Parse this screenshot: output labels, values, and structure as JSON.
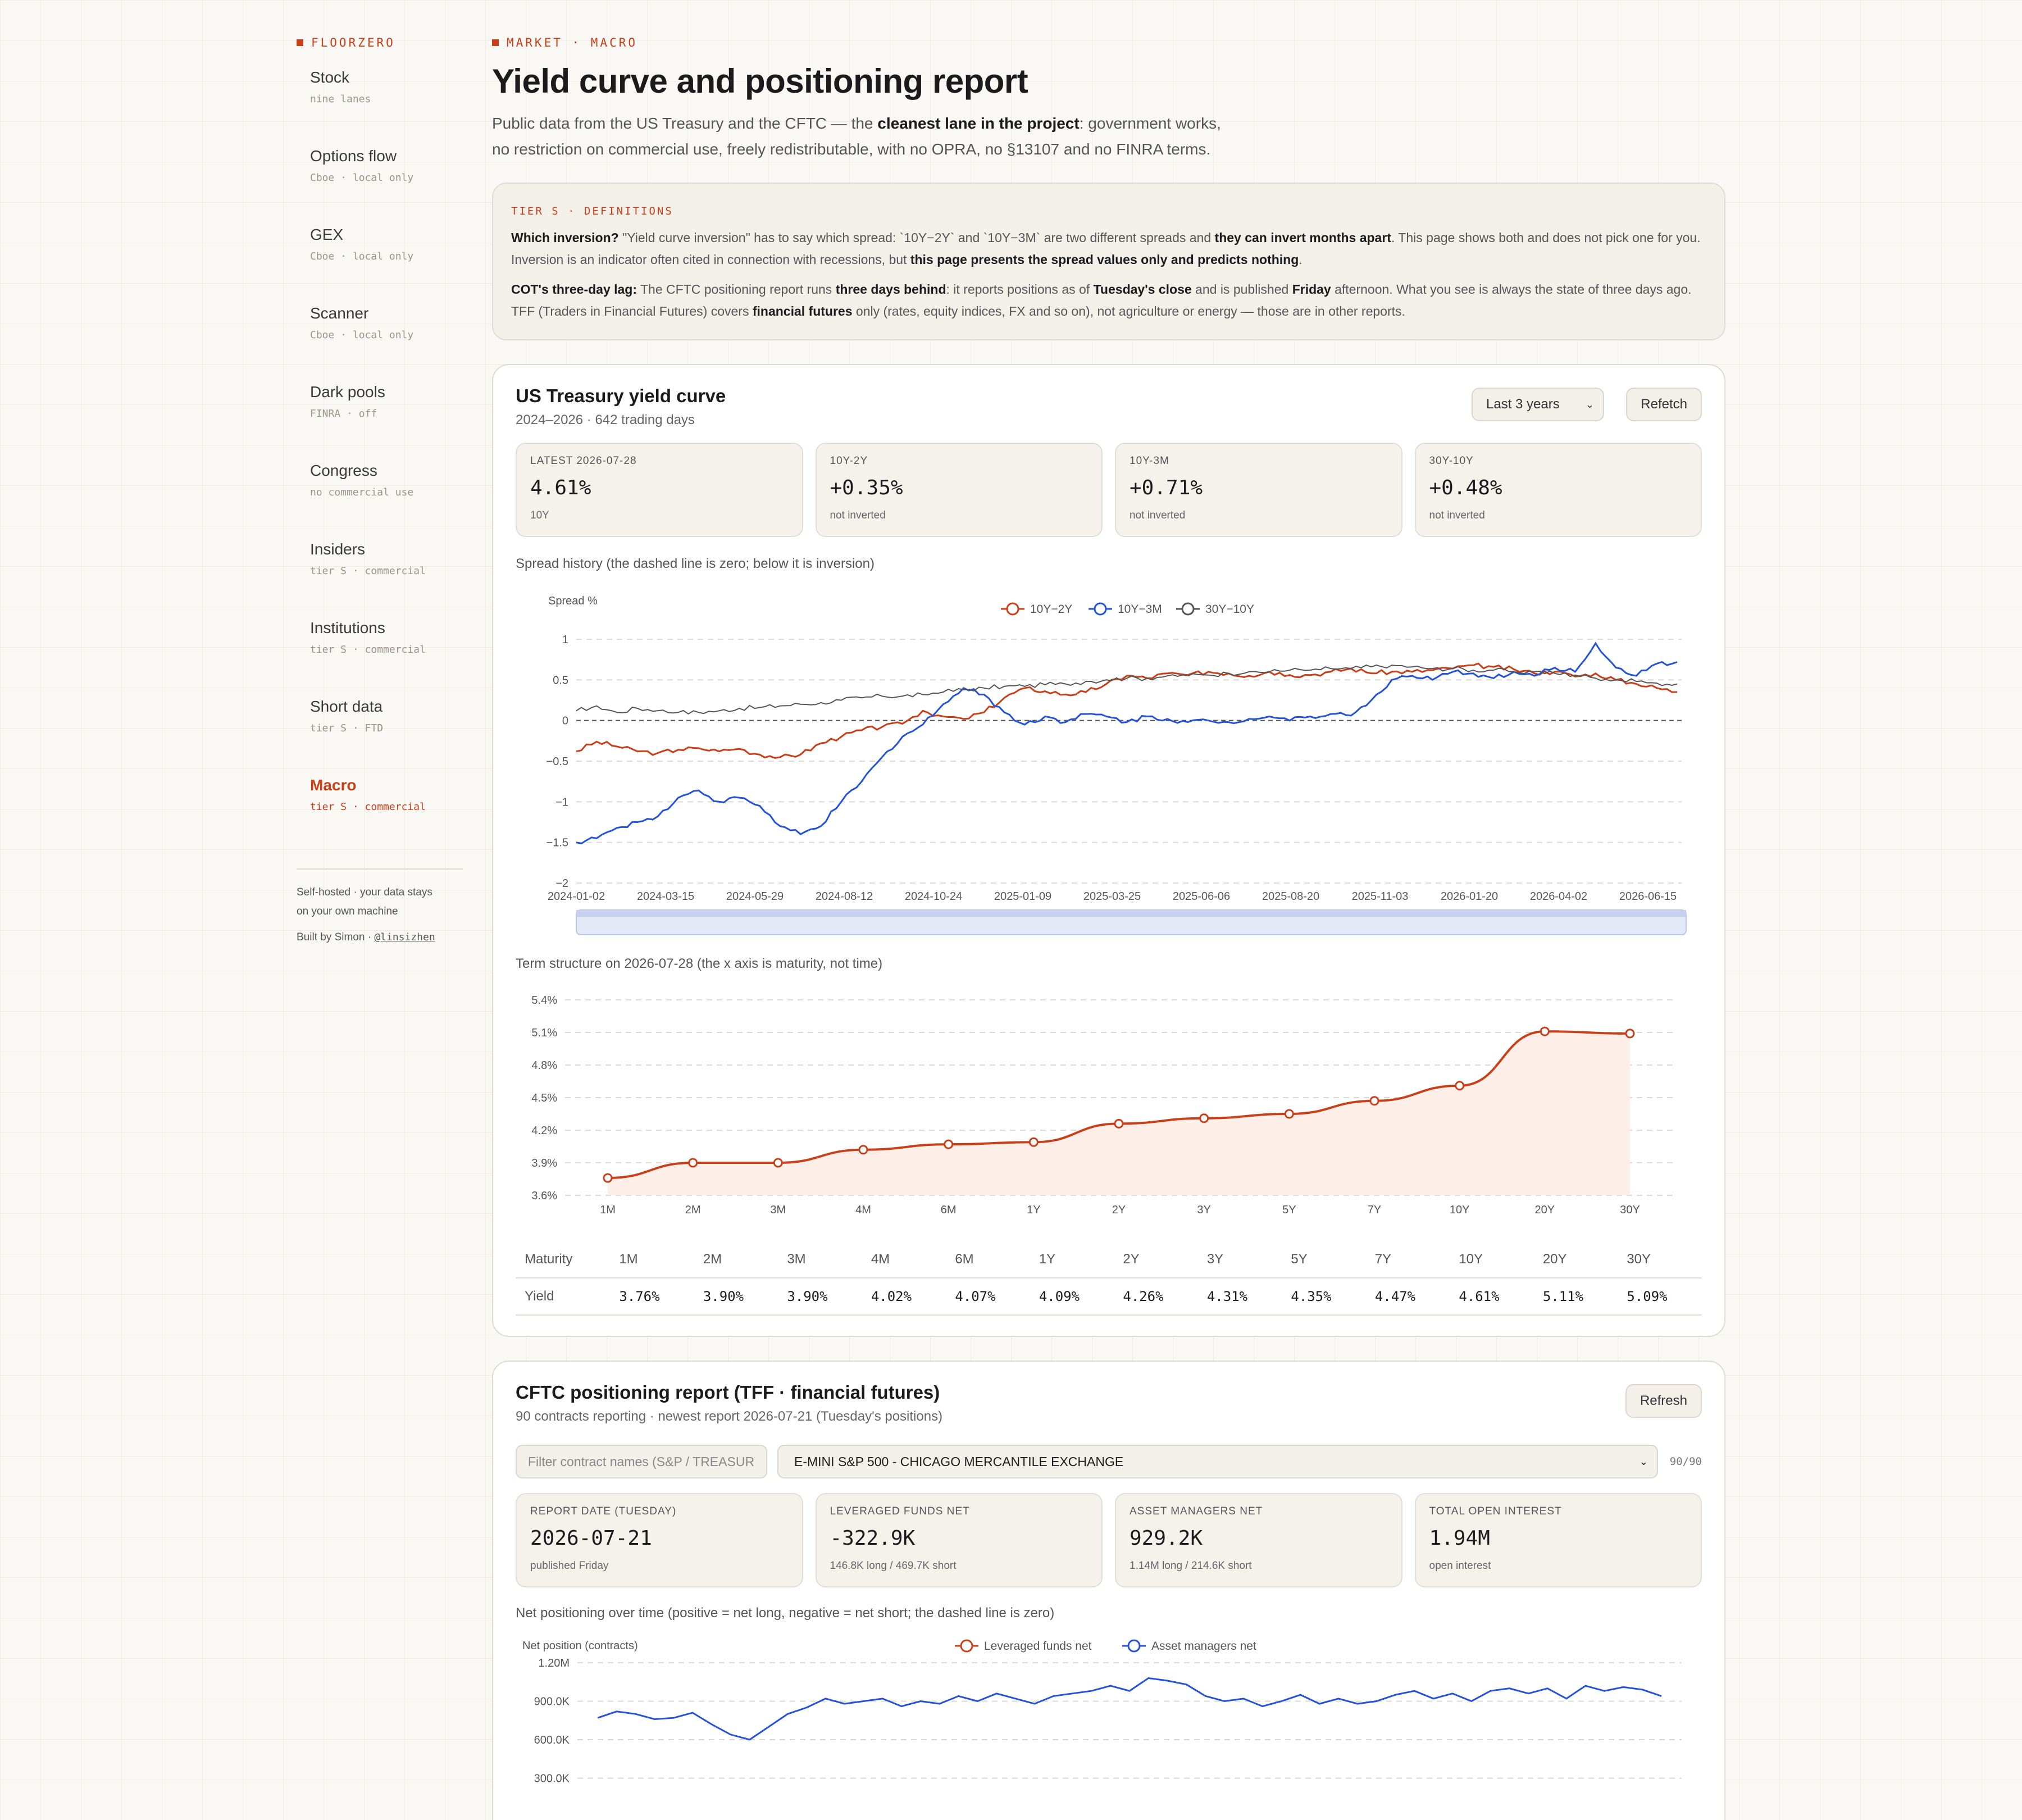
{
  "sidebar": {
    "brand": "FLOORZERO",
    "items": [
      {
        "title": "Stock",
        "sub": "nine lanes"
      },
      {
        "title": "Options flow",
        "sub": "Cboe · local only"
      },
      {
        "title": "GEX",
        "sub": "Cboe · local only"
      },
      {
        "title": "Scanner",
        "sub": "Cboe · local only"
      },
      {
        "title": "Dark pools",
        "sub": "FINRA · off"
      },
      {
        "title": "Congress",
        "sub": "no commercial use"
      },
      {
        "title": "Insiders",
        "sub": "tier S · commercial"
      },
      {
        "title": "Institutions",
        "sub": "tier S · commercial"
      },
      {
        "title": "Short data",
        "sub": "tier S · FTD"
      },
      {
        "title": "Macro",
        "sub": "tier S · commercial"
      }
    ],
    "footer_line1": "Self-hosted · your data stays",
    "footer_line2": "on your own machine",
    "built_by": "Built by Simon · ",
    "handle": "@linsizhen"
  },
  "header": {
    "crumb": "MARKET · MACRO",
    "title": "Yield curve and positioning report",
    "intro_a": "Public data from the US Treasury and the CFTC — the ",
    "intro_b": "cleanest lane in the project",
    "intro_c": ": government works, no restriction on commercial use, freely redistributable, with no OPRA, no §13107 and no FINRA terms."
  },
  "definitions": {
    "tag": "TIER S · DEFINITIONS",
    "p1_q": "Which inversion?",
    "p1_a": " \"Yield curve inversion\" has to say which spread: `10Y−2Y` and `10Y−3M` are two different spreads and ",
    "p1_b": "they can invert months apart",
    "p1_c": ". This page shows both and does not pick one for you. Inversion is an indicator often cited in connection with recessions, but ",
    "p1_d": "this page presents the spread values only and predicts nothing",
    "p1_e": ".",
    "p2_q": "COT's three-day lag:",
    "p2_a": " The CFTC positioning report runs ",
    "p2_b": "three days behind",
    "p2_c": ": it reports positions as of ",
    "p2_d": "Tuesday's close",
    "p2_e": " and is published ",
    "p2_f": "Friday",
    "p2_g": " afternoon. What you see is always the state of three days ago. TFF (Traders in Financial Futures) covers ",
    "p2_h": "financial futures",
    "p2_i": " only (rates, equity indices, FX and so on), not agriculture or energy — those are in other reports."
  },
  "yield_card": {
    "title": "US Treasury yield curve",
    "subtitle": "2024–2026 · 642 trading days",
    "range": "Last 3 years",
    "refetch": "Refetch",
    "stats": [
      {
        "label": "LATEST 2026-07-28",
        "value": "4.61%",
        "note": "10Y"
      },
      {
        "label": "10Y-2Y",
        "value": "+0.35%",
        "note": "not inverted"
      },
      {
        "label": "10Y-3M",
        "value": "+0.71%",
        "note": "not inverted"
      },
      {
        "label": "30Y-10Y",
        "value": "+0.48%",
        "note": "not inverted"
      }
    ],
    "spread_label": "Spread history (the dashed line is zero; below it is inversion)",
    "term_label": "Term structure on 2026-07-28 (the x axis is maturity, not time)",
    "table_head": "Maturity",
    "table_row": "Yield"
  },
  "cot_card": {
    "title": "CFTC positioning report (TFF · financial futures)",
    "subtitle": "90 contracts reporting · newest report 2026-07-21 (Tuesday's positions)",
    "refresh": "Refresh",
    "filter_placeholder": "Filter contract names (S&P / TREASURY …)",
    "contract": "E-MINI S&P 500 - CHICAGO MERCANTILE EXCHANGE",
    "count": "90/90",
    "stats": [
      {
        "label": "REPORT DATE (TUESDAY)",
        "value": "2026-07-21",
        "note": "published Friday"
      },
      {
        "label": "LEVERAGED FUNDS NET",
        "value": "-322.9K",
        "note": "146.8K long / 469.7K short"
      },
      {
        "label": "ASSET MANAGERS NET",
        "value": "929.2K",
        "note": "1.14M long / 214.6K short"
      },
      {
        "label": "TOTAL OPEN INTEREST",
        "value": "1.94M",
        "note": "open interest"
      }
    ],
    "net_label": "Net positioning over time (positive = net long, negative = net short; the dashed line is zero)"
  },
  "colors": {
    "accent": "#c8401a",
    "blue": "#2553d6",
    "grey": "#555555"
  },
  "chart_data": [
    {
      "type": "line",
      "ylabel": "Spread %",
      "ylim": [
        -2,
        1
      ],
      "yticks": [
        1,
        0.5,
        0,
        -0.5,
        -1,
        -1.5,
        -2
      ],
      "xticks": [
        "2024-01-02",
        "2024-03-15",
        "2024-05-29",
        "2024-08-12",
        "2024-10-24",
        "2025-01-09",
        "2025-03-25",
        "2025-06-06",
        "2025-08-20",
        "2025-11-03",
        "2026-01-20",
        "2026-04-02",
        "2026-06-15"
      ],
      "legend_position": "top-center",
      "series": [
        {
          "name": "10Y−2Y",
          "color": "#c8401a",
          "values": [
            -0.38,
            -0.26,
            -0.32,
            -0.38,
            -0.4,
            -0.36,
            -0.34,
            -0.38,
            -0.35,
            -0.42,
            -0.45,
            -0.42,
            -0.28,
            -0.2,
            -0.12,
            -0.08,
            -0.04,
            0.12,
            0.05,
            0.02,
            0.1,
            0.28,
            0.4,
            0.36,
            0.32,
            0.35,
            0.45,
            0.55,
            0.52,
            0.58,
            0.56,
            0.6,
            0.58,
            0.55,
            0.6,
            0.56,
            0.56,
            0.6,
            0.64,
            0.58,
            0.6,
            0.6,
            0.62,
            0.64,
            0.68,
            0.66,
            0.63,
            0.58,
            0.6,
            0.54,
            0.58,
            0.5,
            0.45,
            0.4,
            0.35
          ]
        },
        {
          "name": "10Y−3M",
          "color": "#2553d6",
          "values": [
            -1.5,
            -1.45,
            -1.32,
            -1.25,
            -1.18,
            -0.95,
            -0.86,
            -1.0,
            -0.95,
            -1.05,
            -1.3,
            -1.4,
            -1.3,
            -1.0,
            -0.75,
            -0.45,
            -0.2,
            -0.05,
            0.2,
            0.4,
            0.32,
            0.1,
            -0.05,
            0.05,
            -0.02,
            0.08,
            0.05,
            -0.02,
            0.05,
            0.02,
            -0.02,
            0.0,
            -0.02,
            0.02,
            0.05,
            0.0,
            0.05,
            0.08,
            0.06,
            0.25,
            0.5,
            0.55,
            0.5,
            0.6,
            0.58,
            0.52,
            0.6,
            0.55,
            0.65,
            0.6,
            0.95,
            0.65,
            0.55,
            0.7,
            0.72
          ]
        },
        {
          "name": "30Y−10Y",
          "color": "#555555",
          "values": [
            0.12,
            0.18,
            0.1,
            0.15,
            0.12,
            0.1,
            0.1,
            0.12,
            0.15,
            0.16,
            0.18,
            0.2,
            0.22,
            0.25,
            0.28,
            0.3,
            0.3,
            0.32,
            0.35,
            0.38,
            0.4,
            0.42,
            0.42,
            0.44,
            0.45,
            0.48,
            0.5,
            0.52,
            0.52,
            0.55,
            0.55,
            0.56,
            0.58,
            0.6,
            0.6,
            0.62,
            0.62,
            0.64,
            0.64,
            0.66,
            0.68,
            0.66,
            0.64,
            0.64,
            0.62,
            0.62,
            0.6,
            0.6,
            0.58,
            0.56,
            0.52,
            0.5,
            0.48,
            0.46,
            0.45
          ]
        }
      ]
    },
    {
      "type": "area",
      "categories": [
        "1M",
        "2M",
        "3M",
        "4M",
        "6M",
        "1Y",
        "2Y",
        "3Y",
        "5Y",
        "7Y",
        "10Y",
        "20Y",
        "30Y"
      ],
      "values": [
        3.76,
        3.9,
        3.9,
        4.02,
        4.07,
        4.09,
        4.26,
        4.31,
        4.35,
        4.47,
        4.61,
        5.11,
        5.09
      ],
      "labels": [
        "3.76%",
        "3.90%",
        "3.90%",
        "4.02%",
        "4.07%",
        "4.09%",
        "4.26%",
        "4.31%",
        "4.35%",
        "4.47%",
        "4.61%",
        "5.11%",
        "5.09%"
      ],
      "ylim": [
        3.6,
        5.4
      ],
      "yticks": [
        "5.4%",
        "5.1%",
        "4.8%",
        "4.5%",
        "4.2%",
        "3.9%",
        "3.6%"
      ],
      "ytick_values": [
        5.4,
        5.1,
        4.8,
        4.5,
        4.2,
        3.9,
        3.6
      ]
    },
    {
      "type": "line",
      "ylabel": "Net position (contracts)",
      "yticks": [
        "1.20M",
        "900.0K",
        "600.0K",
        "300.0K"
      ],
      "ytick_values": [
        1200000,
        900000,
        600000,
        300000
      ],
      "legend_position": "top-center",
      "series": [
        {
          "name": "Leveraged funds net",
          "color": "#c8401a",
          "values": []
        },
        {
          "name": "Asset managers net",
          "color": "#2553d6",
          "values": [
            770000,
            820000,
            800000,
            760000,
            770000,
            810000,
            720000,
            640000,
            600000,
            700000,
            800000,
            850000,
            920000,
            880000,
            900000,
            920000,
            860000,
            900000,
            880000,
            940000,
            900000,
            960000,
            920000,
            880000,
            940000,
            960000,
            980000,
            1020000,
            980000,
            1080000,
            1060000,
            1030000,
            940000,
            900000,
            920000,
            860000,
            900000,
            950000,
            880000,
            920000,
            880000,
            900000,
            950000,
            980000,
            920000,
            960000,
            900000,
            980000,
            1000000,
            960000,
            1000000,
            920000,
            1020000,
            980000,
            1010000,
            990000,
            940000
          ]
        }
      ]
    }
  ]
}
